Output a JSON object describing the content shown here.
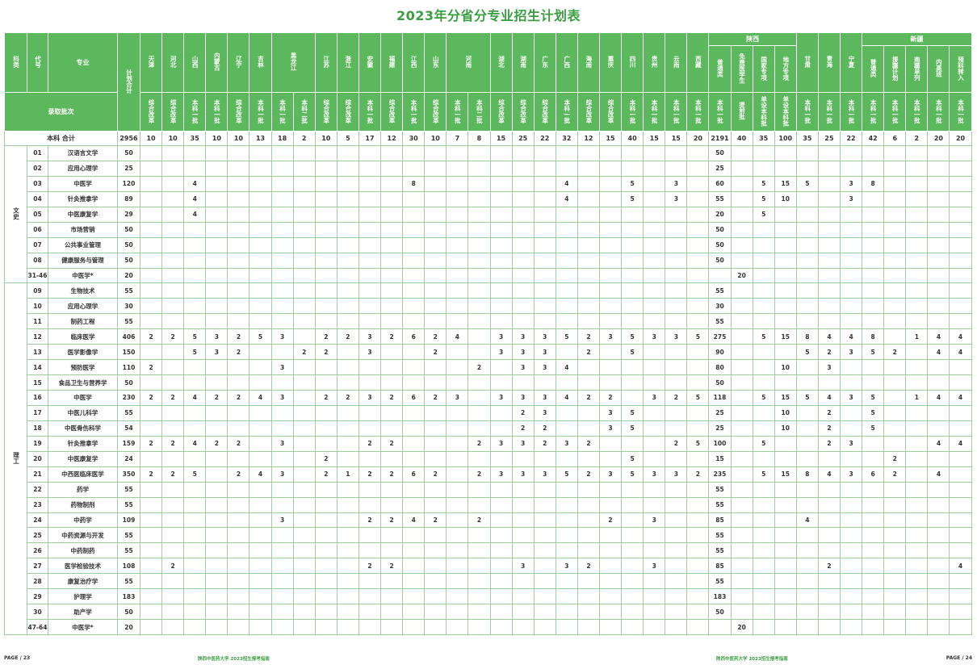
{
  "title": "2023年分省分专业招生计划表",
  "header": {
    "category": "科类",
    "code": "代号",
    "major": "专业",
    "plan_total": "计划合计",
    "batch_label": "录取批次",
    "shaanxi": "陕西",
    "xinjiang": "新疆"
  },
  "columns": [
    {
      "name": "天津",
      "batch": "综合改革"
    },
    {
      "name": "河北",
      "batch": "综合改革"
    },
    {
      "name": "山西",
      "batch": "本科一批"
    },
    {
      "name": "内蒙古",
      "batch": "本科一批"
    },
    {
      "name": "辽宁",
      "batch": "综合改革"
    },
    {
      "name": "吉林",
      "batch": "本科一批"
    },
    {
      "name": "黑龙江",
      "batch": "本科一批"
    },
    {
      "name": "",
      "batch": "本科二批"
    },
    {
      "name": "江苏",
      "batch": "综合改革"
    },
    {
      "name": "浙江",
      "batch": "综合改革"
    },
    {
      "name": "安徽",
      "batch": "本科一批"
    },
    {
      "name": "福建",
      "batch": "综合改革"
    },
    {
      "name": "江西",
      "batch": "本科一批"
    },
    {
      "name": "山东",
      "batch": "综合改革"
    },
    {
      "name": "河南",
      "batch": "本科一批"
    },
    {
      "name": "",
      "batch": "本科二批"
    },
    {
      "name": "湖北",
      "batch": "综合改革"
    },
    {
      "name": "湖南",
      "batch": "综合改革"
    },
    {
      "name": "广东",
      "batch": "综合改革"
    },
    {
      "name": "广西",
      "batch": "本科一批"
    },
    {
      "name": "海南",
      "batch": "综合改革"
    },
    {
      "name": "重庆",
      "batch": "综合改革"
    },
    {
      "name": "四川",
      "batch": "本科一批"
    },
    {
      "name": "贵州",
      "batch": "本科一批"
    },
    {
      "name": "云南",
      "batch": "本科一批"
    },
    {
      "name": "西藏",
      "batch": "本科一批"
    },
    {
      "name": "普通类",
      "batch": "本科一批",
      "group": "shaanxi"
    },
    {
      "name": "免费医学生",
      "batch": "提前批",
      "group": "shaanxi"
    },
    {
      "name": "国家专项",
      "batch": "单设本科批",
      "group": "shaanxi"
    },
    {
      "name": "地方专项",
      "batch": "单设本科批",
      "group": "shaanxi"
    },
    {
      "name": "甘肃",
      "batch": "本科一批"
    },
    {
      "name": "青海",
      "batch": "本科一批"
    },
    {
      "name": "宁夏",
      "batch": "本科一批"
    },
    {
      "name": "普通类",
      "batch": "本科一批",
      "group": "xinjiang"
    },
    {
      "name": "援疆计划",
      "batch": "本科一批",
      "group": "xinjiang"
    },
    {
      "name": "南疆单列",
      "batch": "本科一批",
      "group": "xinjiang"
    },
    {
      "name": "内高班",
      "batch": "本科一批",
      "group": "xinjiang"
    },
    {
      "name": "预科转入",
      "batch": "本科一批",
      "group": "xinjiang"
    }
  ],
  "totals": {
    "label": "本科 合计",
    "plan": "2956",
    "values": [
      "10",
      "10",
      "35",
      "10",
      "10",
      "13",
      "18",
      "2",
      "10",
      "5",
      "17",
      "12",
      "30",
      "10",
      "7",
      "8",
      "15",
      "25",
      "22",
      "32",
      "12",
      "15",
      "40",
      "15",
      "15",
      "20",
      "2191",
      "40",
      "35",
      "100",
      "35",
      "25",
      "22",
      "42",
      "6",
      "2",
      "20",
      "20"
    ]
  },
  "groups": [
    {
      "category": "文史",
      "rows": [
        {
          "code": "01",
          "name": "汉语言文学",
          "plan": "50",
          "cells": {
            "26": "50"
          }
        },
        {
          "code": "02",
          "name": "应用心理学",
          "plan": "25",
          "cells": {
            "26": "25"
          }
        },
        {
          "code": "03",
          "name": "中医学",
          "plan": "120",
          "cells": {
            "2": "4",
            "12": "8",
            "19": "4",
            "22": "5",
            "24": "3",
            "26": "60",
            "28": "5",
            "29": "15",
            "30": "5",
            "32": "3",
            "33": "8"
          }
        },
        {
          "code": "04",
          "name": "针灸推拿学",
          "plan": "89",
          "cells": {
            "2": "4",
            "19": "4",
            "22": "5",
            "24": "3",
            "26": "55",
            "28": "5",
            "29": "10",
            "32": "3"
          }
        },
        {
          "code": "05",
          "name": "中医康复学",
          "plan": "29",
          "cells": {
            "2": "4",
            "26": "20",
            "28": "5"
          }
        },
        {
          "code": "06",
          "name": "市场营销",
          "plan": "50",
          "cells": {
            "26": "50"
          }
        },
        {
          "code": "07",
          "name": "公共事业管理",
          "plan": "50",
          "cells": {
            "26": "50"
          }
        },
        {
          "code": "08",
          "name": "健康服务与管理",
          "plan": "50",
          "cells": {
            "26": "50"
          }
        },
        {
          "code": "31-46",
          "name": "中医学*",
          "plan": "20",
          "cells": {
            "27": "20"
          }
        }
      ]
    },
    {
      "category": "理工",
      "rows": [
        {
          "code": "09",
          "name": "生物技术",
          "plan": "55",
          "cells": {
            "26": "55"
          }
        },
        {
          "code": "10",
          "name": "应用心理学",
          "plan": "30",
          "cells": {
            "26": "30"
          }
        },
        {
          "code": "11",
          "name": "制药工程",
          "plan": "55",
          "cells": {
            "26": "55"
          }
        },
        {
          "code": "12",
          "name": "临床医学",
          "plan": "406",
          "cells": {
            "0": "2",
            "1": "2",
            "2": "5",
            "3": "3",
            "4": "2",
            "5": "5",
            "6": "3",
            "8": "2",
            "9": "2",
            "10": "3",
            "11": "2",
            "12": "6",
            "13": "2",
            "14": "4",
            "16": "3",
            "17": "3",
            "18": "3",
            "19": "5",
            "20": "2",
            "21": "3",
            "22": "5",
            "23": "3",
            "24": "3",
            "25": "5",
            "26": "275",
            "28": "5",
            "29": "15",
            "30": "8",
            "31": "4",
            "32": "4",
            "33": "8",
            "35": "1",
            "36": "4",
            "37": "4"
          }
        },
        {
          "code": "13",
          "name": "医学影像学",
          "plan": "150",
          "cells": {
            "2": "5",
            "3": "3",
            "4": "2",
            "7": "2",
            "8": "2",
            "10": "3",
            "13": "2",
            "16": "3",
            "17": "3",
            "18": "3",
            "20": "2",
            "22": "5",
            "26": "90",
            "30": "5",
            "31": "2",
            "32": "3",
            "33": "5",
            "34": "2",
            "36": "4",
            "37": "4"
          }
        },
        {
          "code": "14",
          "name": "预防医学",
          "plan": "110",
          "cells": {
            "0": "2",
            "6": "3",
            "15": "2",
            "17": "3",
            "18": "3",
            "19": "4",
            "26": "80",
            "29": "10",
            "31": "3"
          }
        },
        {
          "code": "15",
          "name": "食品卫生与营养学",
          "plan": "50",
          "cells": {
            "26": "50"
          }
        },
        {
          "code": "16",
          "name": "中医学",
          "plan": "230",
          "cells": {
            "0": "2",
            "1": "2",
            "2": "4",
            "3": "2",
            "4": "2",
            "5": "4",
            "6": "3",
            "8": "2",
            "9": "2",
            "10": "3",
            "11": "2",
            "12": "6",
            "13": "2",
            "14": "3",
            "16": "3",
            "17": "3",
            "18": "3",
            "19": "4",
            "20": "2",
            "21": "2",
            "23": "3",
            "24": "2",
            "25": "5",
            "26": "118",
            "28": "5",
            "29": "15",
            "30": "5",
            "31": "4",
            "32": "3",
            "33": "5",
            "35": "1",
            "36": "4",
            "37": "4"
          }
        },
        {
          "code": "17",
          "name": "中医儿科学",
          "plan": "55",
          "cells": {
            "17": "2",
            "18": "3",
            "21": "3",
            "22": "5",
            "26": "25",
            "29": "10",
            "31": "2",
            "33": "5"
          }
        },
        {
          "code": "18",
          "name": "中医骨伤科学",
          "plan": "54",
          "cells": {
            "17": "2",
            "18": "2",
            "21": "3",
            "22": "5",
            "26": "25",
            "29": "10",
            "31": "2",
            "33": "5"
          }
        },
        {
          "code": "19",
          "name": "针灸推拿学",
          "plan": "159",
          "cells": {
            "0": "2",
            "1": "2",
            "2": "4",
            "3": "2",
            "4": "2",
            "6": "3",
            "10": "2",
            "11": "2",
            "15": "2",
            "16": "3",
            "17": "3",
            "18": "2",
            "19": "3",
            "20": "2",
            "24": "2",
            "25": "5",
            "26": "100",
            "28": "5",
            "31": "2",
            "32": "3",
            "36": "4",
            "37": "4"
          }
        },
        {
          "code": "20",
          "name": "中医康复学",
          "plan": "24",
          "cells": {
            "8": "2",
            "22": "5",
            "26": "15",
            "34": "2"
          }
        },
        {
          "code": "21",
          "name": "中西医临床医学",
          "plan": "350",
          "cells": {
            "0": "2",
            "1": "2",
            "2": "5",
            "4": "2",
            "5": "4",
            "6": "3",
            "8": "2",
            "9": "1",
            "10": "2",
            "11": "2",
            "12": "6",
            "13": "2",
            "15": "2",
            "16": "3",
            "17": "3",
            "18": "3",
            "19": "5",
            "20": "2",
            "21": "3",
            "22": "5",
            "23": "3",
            "24": "3",
            "25": "2",
            "26": "235",
            "28": "5",
            "29": "15",
            "30": "8",
            "31": "4",
            "32": "3",
            "33": "6",
            "34": "2",
            "36": "4"
          }
        },
        {
          "code": "22",
          "name": "药学",
          "plan": "55",
          "cells": {
            "26": "55"
          }
        },
        {
          "code": "23",
          "name": "药物制剂",
          "plan": "55",
          "cells": {
            "26": "55"
          }
        },
        {
          "code": "24",
          "name": "中药学",
          "plan": "109",
          "cells": {
            "6": "3",
            "10": "2",
            "11": "2",
            "12": "4",
            "13": "2",
            "15": "2",
            "21": "2",
            "23": "3",
            "26": "85",
            "30": "4"
          }
        },
        {
          "code": "25",
          "name": "中药资源与开发",
          "plan": "55",
          "cells": {
            "26": "55"
          }
        },
        {
          "code": "26",
          "name": "中药制药",
          "plan": "55",
          "cells": {
            "26": "55"
          }
        },
        {
          "code": "27",
          "name": "医学检验技术",
          "plan": "108",
          "cells": {
            "1": "2",
            "10": "2",
            "11": "2",
            "17": "3",
            "19": "3",
            "20": "2",
            "23": "3",
            "26": "85",
            "31": "2",
            "37": "4"
          }
        },
        {
          "code": "28",
          "name": "康复治疗学",
          "plan": "55",
          "cells": {
            "26": "55"
          }
        },
        {
          "code": "29",
          "name": "护理学",
          "plan": "183",
          "cells": {
            "26": "183"
          }
        },
        {
          "code": "30",
          "name": "助产学",
          "plan": "50",
          "cells": {
            "26": "50"
          }
        },
        {
          "code": "47-64",
          "name": "中医学*",
          "plan": "20",
          "cells": {
            "27": "20"
          }
        }
      ]
    }
  ],
  "footer": {
    "left_page": "PAGE  /  23",
    "right_page": "PAGE  /  24",
    "brand_left": "陕西中医药大学 2023招生报考指南",
    "brand_right": "陕西中医药大学 2023招生报考指南"
  }
}
